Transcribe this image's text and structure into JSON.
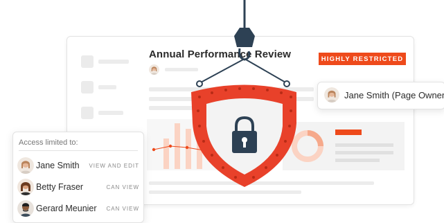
{
  "document": {
    "title": "Annual Performance Review",
    "badge": "HIGHLY RESTRICTED"
  },
  "owner": {
    "label": "Jane Smith (Page Owner)"
  },
  "access": {
    "title": "Access limited to:",
    "users": [
      {
        "name": "Jane Smith",
        "permission": "VIEW AND EDIT"
      },
      {
        "name": "Betty Fraser",
        "permission": "CAN VIEW"
      },
      {
        "name": "Gerard Meunier",
        "permission": "CAN VIEW"
      }
    ]
  },
  "icons": [
    "shield-icon",
    "lock-icon",
    "hook-icon"
  ],
  "colors": {
    "accent": "#ee4a1b",
    "accent_light": "#fbd3c3",
    "shield_inner": "#f3f3f3"
  }
}
